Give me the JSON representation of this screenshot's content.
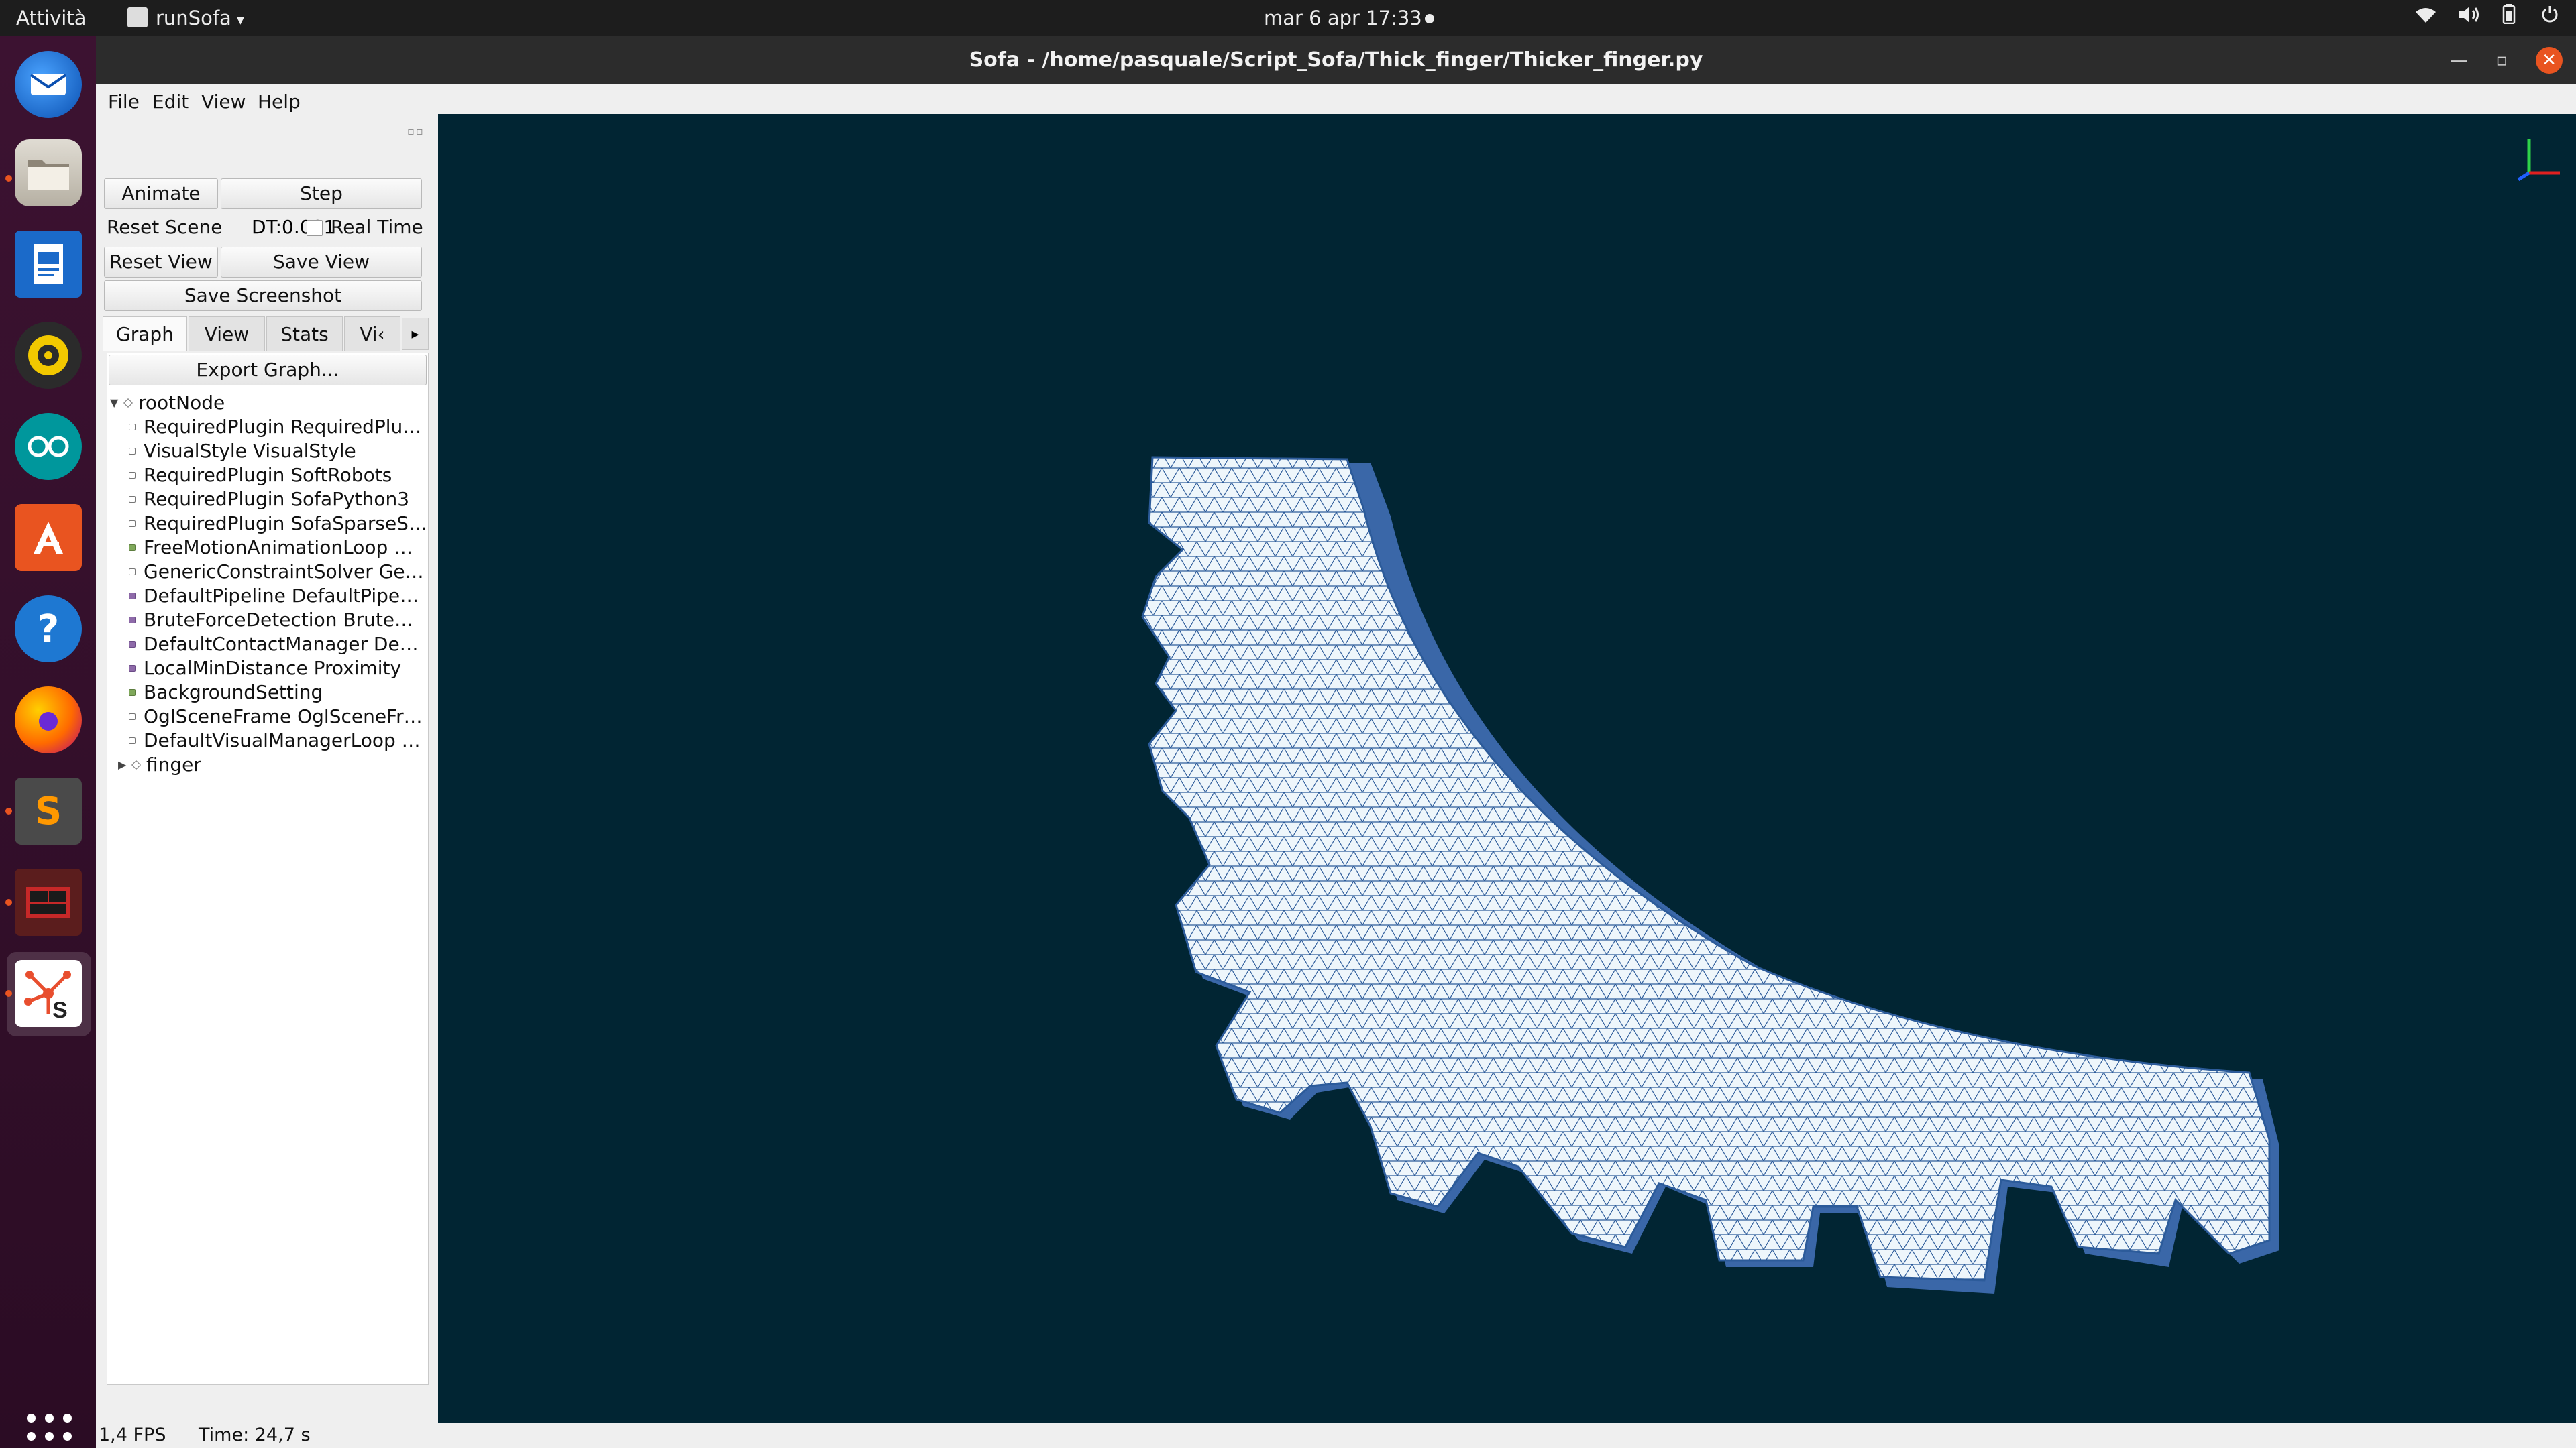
{
  "topbar": {
    "activities": "Attività",
    "app_name": "runSofa",
    "clock": "mar 6 apr  17:33",
    "tray_icons": [
      "wifi-icon",
      "volume-icon",
      "battery-icon",
      "power-menu-icon"
    ]
  },
  "dock": {
    "items": [
      "thunderbird-icon",
      "files-icon",
      "libreoffice-writer-icon",
      "rhythmbox-icon",
      "arduino-icon",
      "ubuntu-software-icon",
      "help-icon",
      "firefox-icon",
      "sublime-text-icon",
      "terminal-app-icon",
      "sofa-icon"
    ],
    "show_apps": "show-applications-icon"
  },
  "window": {
    "title": "Sofa - /home/pasquale/Script_Sofa/Thick_finger/Thicker_finger.py"
  },
  "menu": {
    "file": "File",
    "edit": "Edit",
    "view": "View",
    "help": "Help"
  },
  "controls": {
    "animate": "Animate",
    "step": "Step",
    "reset_scene": "Reset Scene",
    "dt_label": "DT:",
    "dt_value": "0.001",
    "real_time": "Real Time",
    "reset_view": "Reset View",
    "save_view": "Save View",
    "save_screenshot": "Save Screenshot"
  },
  "tabs": {
    "graph": "Graph",
    "view": "View",
    "stats": "Stats",
    "more": "Vi‹"
  },
  "graph": {
    "export": "Export Graph...",
    "root": "rootNode",
    "nodes": [
      {
        "label": "RequiredPlugin RequiredPlu…",
        "kind": "plain"
      },
      {
        "label": "VisualStyle VisualStyle",
        "kind": "plain"
      },
      {
        "label": "RequiredPlugin SoftRobots",
        "kind": "plain"
      },
      {
        "label": "RequiredPlugin SofaPython3",
        "kind": "plain"
      },
      {
        "label": "RequiredPlugin SofaSparseS…",
        "kind": "plain"
      },
      {
        "label": "FreeMotionAnimationLoop …",
        "kind": "green"
      },
      {
        "label": "GenericConstraintSolver Ge…",
        "kind": "plain"
      },
      {
        "label": "DefaultPipeline DefaultPipe…",
        "kind": "purple"
      },
      {
        "label": "BruteForceDetection Brute…",
        "kind": "purple"
      },
      {
        "label": "DefaultContactManager De…",
        "kind": "purple"
      },
      {
        "label": "LocalMinDistance Proximity",
        "kind": "purple"
      },
      {
        "label": "BackgroundSetting",
        "kind": "green"
      },
      {
        "label": "OglSceneFrame OglSceneFr…",
        "kind": "plain"
      },
      {
        "label": "DefaultVisualManagerLoop …",
        "kind": "plain"
      }
    ],
    "child": "finger"
  },
  "status": {
    "fps": "1,4 FPS",
    "time": "Time: 24,7 s"
  },
  "colors": {
    "viewport_bg": "#012533",
    "mesh_fill": "#eef6fb",
    "mesh_edge": "#2c5b9a",
    "mesh_side": "#3a67a8"
  }
}
